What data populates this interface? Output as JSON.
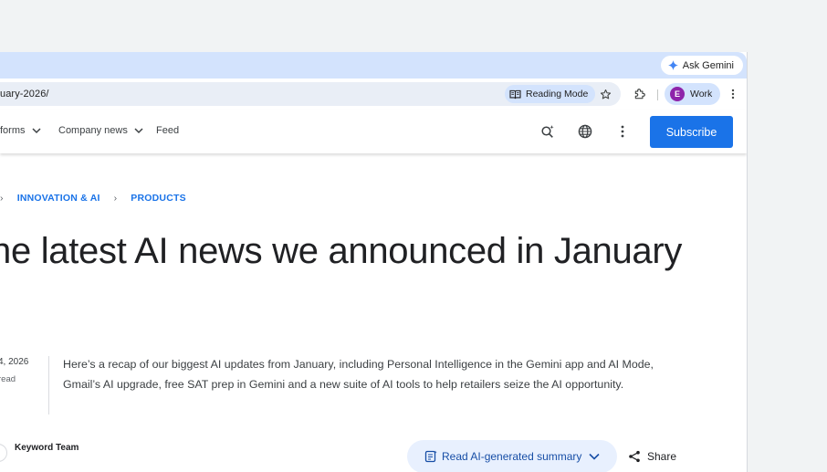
{
  "browser": {
    "ask_gemini": "Ask Gemini",
    "url_fragment": "uary-2026/",
    "reading_mode": "Reading Mode",
    "profile_initial": "E",
    "profile_name": "Work"
  },
  "site_nav": {
    "items": [
      {
        "label": "forms"
      },
      {
        "label": "Company news"
      },
      {
        "label": "Feed"
      }
    ],
    "subscribe_label": "Subscribe"
  },
  "article": {
    "breadcrumbs": [
      "INNOVATION & AI",
      "PRODUCTS"
    ],
    "headline": "he latest AI news we announced in January",
    "date": "4, 2026",
    "read_time": "read",
    "summary": "Here’s a recap of our biggest AI updates from January, including Personal Intelligence in the Gemini app and AI Mode, Gmail’s AI upgrade, free SAT prep in Gemini and a new suite of AI tools to help retailers seize the AI opportunity.",
    "author": "Keyword Team",
    "ai_summary_label": "Read AI-generated summary",
    "share_label": "Share"
  },
  "colors": {
    "tabstrip": "#d3e3fd",
    "accent": "#1a73e8",
    "avatar": "#8e24aa"
  }
}
